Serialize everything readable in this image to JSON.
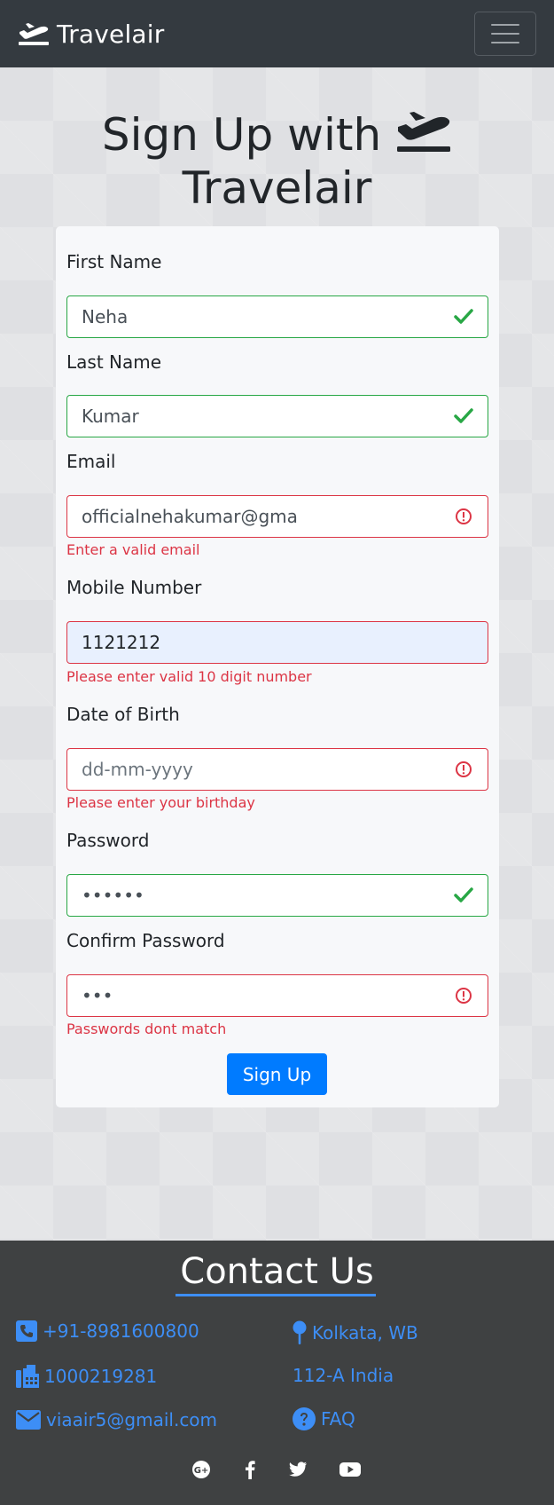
{
  "navbar": {
    "brand": "Travelair",
    "toggler_icon": "hamburger-menu-icon"
  },
  "heading": {
    "line1": "Sign Up with",
    "line2": "Travelair",
    "icon": "plane-departure-icon"
  },
  "form": {
    "first_name": {
      "label": "First Name",
      "value": "Neha",
      "status": "valid"
    },
    "last_name": {
      "label": "Last Name",
      "value": "Kumar",
      "status": "valid"
    },
    "email": {
      "label": "Email",
      "value": "officialnehakumar@gma",
      "status": "invalid",
      "error": "Enter a valid email"
    },
    "mobile": {
      "label": "Mobile Number",
      "value": "1121212",
      "status": "invalid",
      "error": "Please enter valid 10 digit number"
    },
    "dob": {
      "label": "Date of Birth",
      "placeholder": "dd-mm-yyyy",
      "status": "invalid",
      "error": "Please enter your birthday"
    },
    "password": {
      "label": "Password",
      "value": "••••••",
      "status": "valid"
    },
    "confirm_password": {
      "label": "Confirm Password",
      "value": "•••",
      "status": "invalid",
      "error": "Passwords dont match"
    },
    "submit_label": "Sign Up"
  },
  "footer": {
    "title": "Contact Us",
    "phone": "+91-8981600800",
    "fax": "1000219281",
    "email": "viaair5@gmail.com",
    "location": "Kolkata, WB",
    "address": "112-A India",
    "faq": "FAQ",
    "socials": [
      "google-plus-icon",
      "facebook-icon",
      "twitter-icon",
      "youtube-icon"
    ]
  },
  "colors": {
    "navbar": "#343a40",
    "valid": "#28a745",
    "invalid": "#dc3545",
    "primary": "#007bff",
    "link": "#3d8ef6",
    "footer": "#3f4142"
  }
}
